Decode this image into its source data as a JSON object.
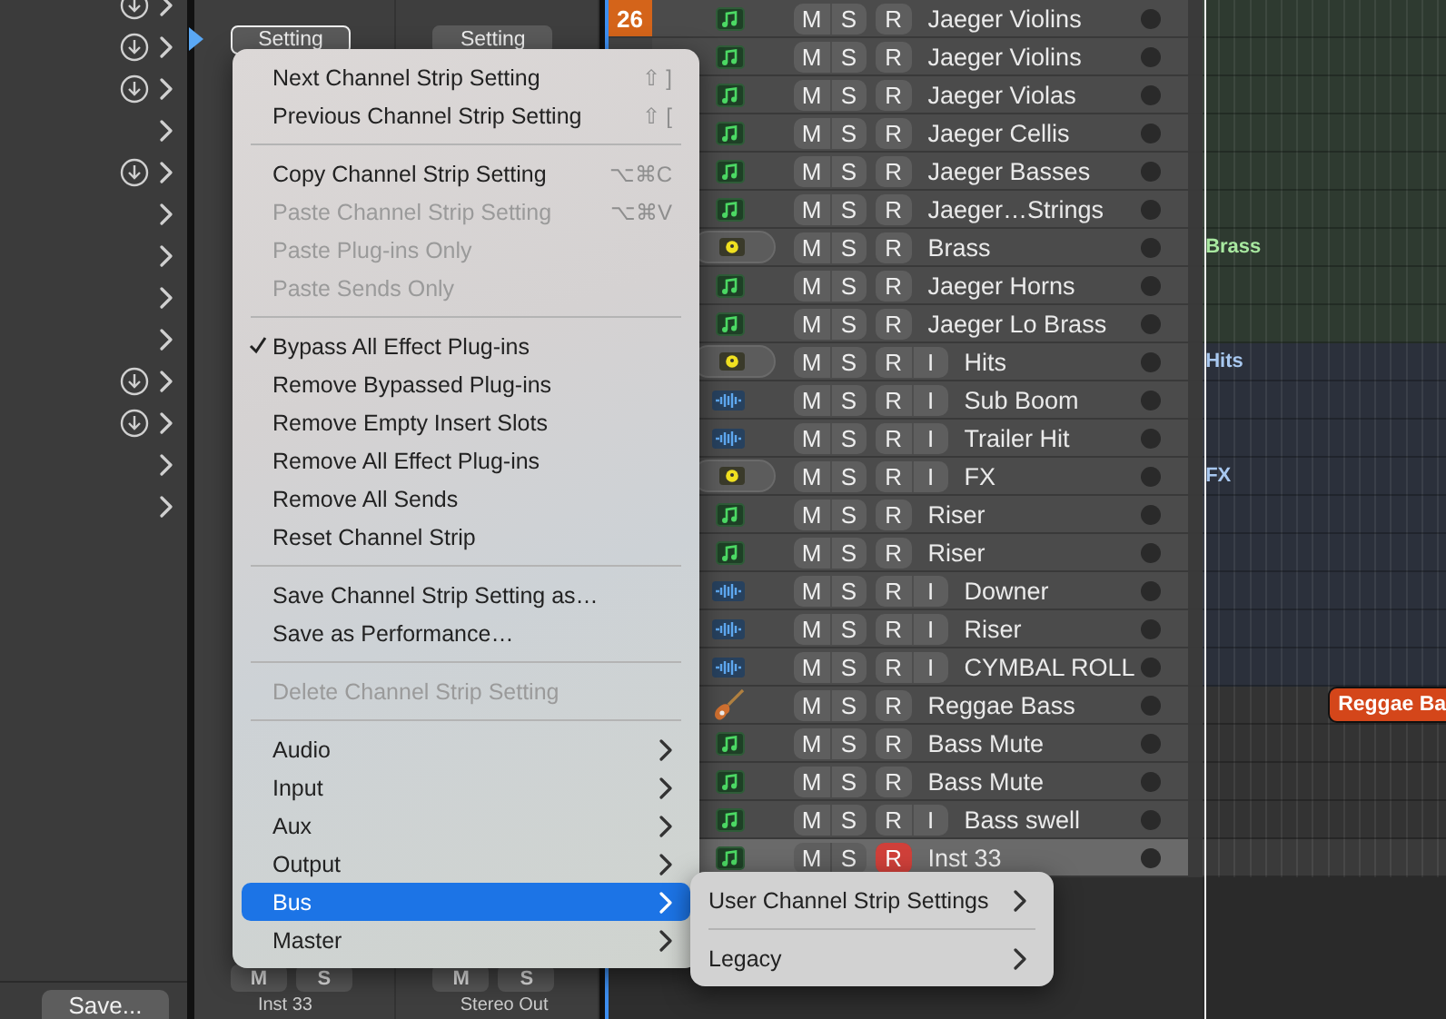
{
  "library": [
    {
      "download": true
    },
    {
      "download": true
    },
    {
      "download": true
    },
    {
      "download": false
    },
    {
      "download": true
    },
    {
      "download": false
    },
    {
      "download": false
    },
    {
      "download": false
    },
    {
      "download": false
    },
    {
      "download": true
    },
    {
      "download": true
    },
    {
      "download": false
    },
    {
      "download": false
    }
  ],
  "library_footer": {
    "save_button": "Save..."
  },
  "mixer": {
    "strips": [
      {
        "setting": "Setting",
        "selected": true,
        "mute": "M",
        "solo": "S",
        "name": "Inst 33"
      },
      {
        "setting": "Setting",
        "selected": false,
        "mute": "M",
        "solo": "S",
        "name": "Stereo Out"
      }
    ]
  },
  "tracks": [
    {
      "number": "26",
      "kind": "midi",
      "mute": "M",
      "solo": "S",
      "record": "R",
      "name": "Jaeger Violins",
      "armed": false,
      "selected": false,
      "color": "#2e3a30"
    },
    {
      "kind": "midi",
      "mute": "M",
      "solo": "S",
      "record": "R",
      "name": "Jaeger Violins",
      "armed": false,
      "selected": false,
      "color": "#2e3a30"
    },
    {
      "kind": "midi",
      "mute": "M",
      "solo": "S",
      "record": "R",
      "name": "Jaeger Violas",
      "armed": false,
      "selected": false,
      "color": "#2e3a30"
    },
    {
      "kind": "midi",
      "mute": "M",
      "solo": "S",
      "record": "R",
      "name": "Jaeger Cellis",
      "armed": false,
      "selected": false,
      "color": "#2e3a30"
    },
    {
      "kind": "midi",
      "mute": "M",
      "solo": "S",
      "record": "R",
      "name": "Jaeger Basses",
      "armed": false,
      "selected": false,
      "color": "#2e3a30"
    },
    {
      "kind": "midi",
      "mute": "M",
      "solo": "S",
      "record": "R",
      "name": "Jaeger…Strings",
      "armed": false,
      "selected": false,
      "color": "#2e3a30"
    },
    {
      "kind": "folder",
      "mute": "M",
      "solo": "S",
      "record": "R",
      "name": "Brass",
      "armed": false,
      "selected": false,
      "color": "#2e3a30",
      "region": {
        "kind": "folder",
        "label": "Brass",
        "color": "#a8e8a0"
      }
    },
    {
      "kind": "midi",
      "mute": "M",
      "solo": "S",
      "record": "R",
      "name": "Jaeger Horns",
      "armed": false,
      "selected": false,
      "color": "#2e3a30"
    },
    {
      "kind": "midi",
      "mute": "M",
      "solo": "S",
      "record": "R",
      "name": "Jaeger Lo Brass",
      "armed": false,
      "selected": false,
      "color": "#2e3a30"
    },
    {
      "kind": "folder",
      "mute": "M",
      "solo": "S",
      "record": "R",
      "input": "I",
      "name": "Hits",
      "armed": false,
      "selected": false,
      "color": "#2b303b",
      "region": {
        "kind": "folder",
        "label": "Hits",
        "color": "#a8c8f0"
      }
    },
    {
      "kind": "audio",
      "mute": "M",
      "solo": "S",
      "record": "R",
      "input": "I",
      "name": "Sub Boom",
      "armed": false,
      "selected": false,
      "color": "#2b303b"
    },
    {
      "kind": "audio",
      "mute": "M",
      "solo": "S",
      "record": "R",
      "input": "I",
      "name": "Trailer Hit",
      "armed": false,
      "selected": false,
      "color": "#2b303b"
    },
    {
      "kind": "folder",
      "mute": "M",
      "solo": "S",
      "record": "R",
      "input": "I",
      "name": "FX",
      "armed": false,
      "selected": false,
      "color": "#2b303b",
      "region": {
        "kind": "folder",
        "label": "FX",
        "color": "#a8c8f0"
      }
    },
    {
      "kind": "midi",
      "mute": "M",
      "solo": "S",
      "record": "R",
      "name": "Riser",
      "armed": false,
      "selected": false,
      "color": "#2b303b"
    },
    {
      "kind": "midi",
      "mute": "M",
      "solo": "S",
      "record": "R",
      "name": "Riser",
      "armed": false,
      "selected": false,
      "color": "#2b303b"
    },
    {
      "kind": "audio",
      "mute": "M",
      "solo": "S",
      "record": "R",
      "input": "I",
      "name": "Downer",
      "armed": false,
      "selected": false,
      "color": "#2b303b"
    },
    {
      "kind": "audio",
      "mute": "M",
      "solo": "S",
      "record": "R",
      "input": "I",
      "name": "Riser",
      "armed": false,
      "selected": false,
      "color": "#2b303b"
    },
    {
      "kind": "audio",
      "mute": "M",
      "solo": "S",
      "record": "R",
      "input": "I",
      "name": "CYMBAL ROLL",
      "armed": false,
      "selected": false,
      "color": "#2b303b"
    },
    {
      "kind": "guitar",
      "mute": "M",
      "solo": "S",
      "record": "R",
      "name": "Reggae Bass",
      "armed": false,
      "selected": false,
      "color": "#333333",
      "region": {
        "kind": "region",
        "label": "Reggae Ba",
        "color": "#d4461a"
      }
    },
    {
      "kind": "midi",
      "mute": "M",
      "solo": "S",
      "record": "R",
      "name": "Bass Mute",
      "armed": false,
      "selected": false,
      "color": "#333333"
    },
    {
      "kind": "midi",
      "mute": "M",
      "solo": "S",
      "record": "R",
      "name": "Bass Mute",
      "armed": false,
      "selected": false,
      "color": "#333333"
    },
    {
      "kind": "midi",
      "mute": "M",
      "solo": "S",
      "record": "R",
      "input": "I",
      "name": "Bass swell",
      "armed": false,
      "selected": false,
      "color": "#333333"
    },
    {
      "kind": "midi",
      "mute": "M",
      "solo": "S",
      "record": "R",
      "name": "Inst 33",
      "armed": true,
      "selected": true,
      "color": "#3a3a3a"
    }
  ],
  "menu": {
    "items": [
      {
        "kind": "item",
        "label": "Next Channel Strip Setting",
        "shortcut": "⇧ ]",
        "disabled": false,
        "checked": false,
        "submenu": false,
        "selected": false
      },
      {
        "kind": "item",
        "label": "Previous Channel Strip Setting",
        "shortcut": "⇧ [",
        "disabled": false,
        "checked": false,
        "submenu": false,
        "selected": false
      },
      {
        "kind": "separator"
      },
      {
        "kind": "item",
        "label": "Copy Channel Strip Setting",
        "shortcut": "⌥⌘C",
        "disabled": false,
        "checked": false,
        "submenu": false,
        "selected": false
      },
      {
        "kind": "item",
        "label": "Paste Channel Strip Setting",
        "shortcut": "⌥⌘V",
        "disabled": true,
        "checked": false,
        "submenu": false,
        "selected": false
      },
      {
        "kind": "item",
        "label": "Paste Plug-ins Only",
        "disabled": true,
        "checked": false,
        "submenu": false,
        "selected": false
      },
      {
        "kind": "item",
        "label": "Paste Sends Only",
        "disabled": true,
        "checked": false,
        "submenu": false,
        "selected": false
      },
      {
        "kind": "separator"
      },
      {
        "kind": "item",
        "label": "Bypass All Effect Plug-ins",
        "disabled": false,
        "checked": true,
        "submenu": false,
        "selected": false
      },
      {
        "kind": "item",
        "label": "Remove Bypassed Plug-ins",
        "disabled": false,
        "checked": false,
        "submenu": false,
        "selected": false
      },
      {
        "kind": "item",
        "label": "Remove Empty Insert Slots",
        "disabled": false,
        "checked": false,
        "submenu": false,
        "selected": false
      },
      {
        "kind": "item",
        "label": "Remove All Effect Plug-ins",
        "disabled": false,
        "checked": false,
        "submenu": false,
        "selected": false
      },
      {
        "kind": "item",
        "label": "Remove All Sends",
        "disabled": false,
        "checked": false,
        "submenu": false,
        "selected": false
      },
      {
        "kind": "item",
        "label": "Reset Channel Strip",
        "disabled": false,
        "checked": false,
        "submenu": false,
        "selected": false
      },
      {
        "kind": "separator"
      },
      {
        "kind": "item",
        "label": "Save Channel Strip Setting as…",
        "disabled": false,
        "checked": false,
        "submenu": false,
        "selected": false
      },
      {
        "kind": "item",
        "label": "Save as Performance…",
        "disabled": false,
        "checked": false,
        "submenu": false,
        "selected": false
      },
      {
        "kind": "separator"
      },
      {
        "kind": "item",
        "label": "Delete Channel Strip Setting",
        "disabled": true,
        "checked": false,
        "submenu": false,
        "selected": false
      },
      {
        "kind": "separator"
      },
      {
        "kind": "item",
        "label": "Audio",
        "disabled": false,
        "checked": false,
        "submenu": true,
        "selected": false
      },
      {
        "kind": "item",
        "label": "Input",
        "disabled": false,
        "checked": false,
        "submenu": true,
        "selected": false
      },
      {
        "kind": "item",
        "label": "Aux",
        "disabled": false,
        "checked": false,
        "submenu": true,
        "selected": false
      },
      {
        "kind": "item",
        "label": "Output",
        "disabled": false,
        "checked": false,
        "submenu": true,
        "selected": false
      },
      {
        "kind": "item",
        "label": "Bus",
        "disabled": false,
        "checked": false,
        "submenu": true,
        "selected": true
      },
      {
        "kind": "item",
        "label": "Master",
        "disabled": false,
        "checked": false,
        "submenu": true,
        "selected": false
      }
    ]
  },
  "submenu": {
    "items": [
      {
        "kind": "item",
        "label": "User Channel Strip Settings",
        "submenu": true,
        "selected": false
      },
      {
        "kind": "separator"
      },
      {
        "kind": "item",
        "label": "Legacy",
        "submenu": true,
        "selected": false
      }
    ]
  }
}
